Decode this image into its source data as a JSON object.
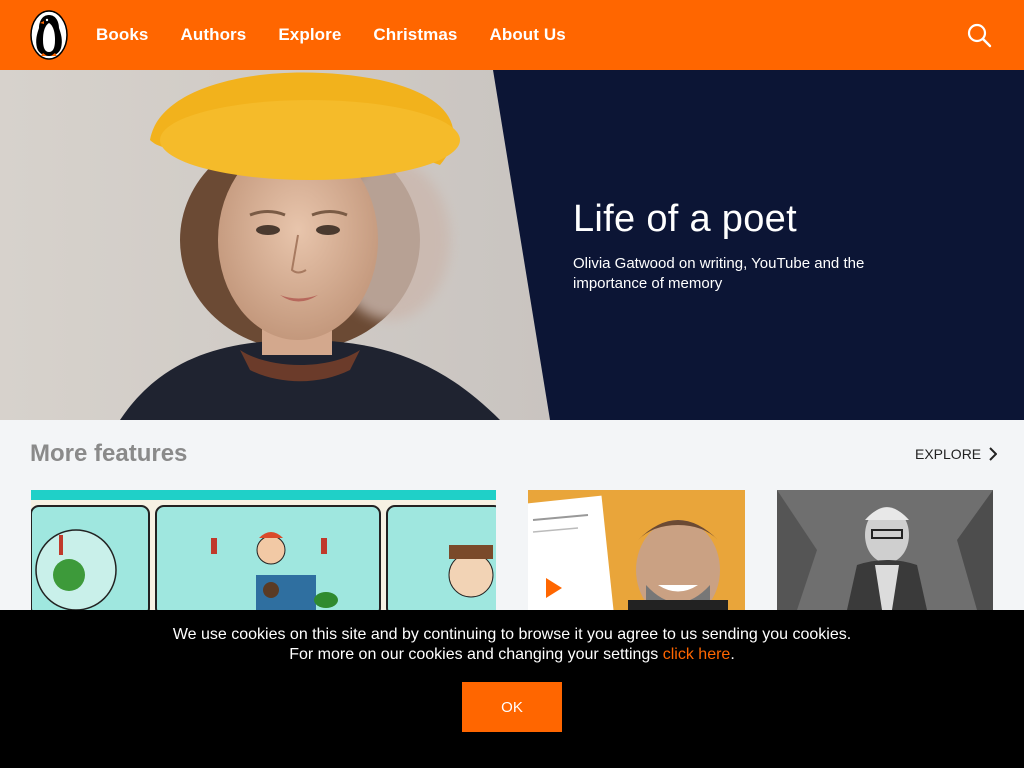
{
  "brand": {
    "logo_icon": "penguin-logo-icon",
    "accent": "#ff6600"
  },
  "nav": {
    "items": [
      "Books",
      "Authors",
      "Explore",
      "Christmas",
      "About Us"
    ],
    "search_icon": "search-icon"
  },
  "hero": {
    "title": "Life of a poet",
    "subtitle": "Olivia Gatwood on writing, YouTube and the importance of memory",
    "background": "#0c1535"
  },
  "features": {
    "title": "More features",
    "explore_label": "EXPLORE"
  },
  "cookie": {
    "line1": "We use cookies on this site and by continuing to browse it you agree to us sending you cookies.",
    "line2_prefix": "For more on our cookies and changing your settings ",
    "link_label": "click here",
    "line2_suffix": ".",
    "ok_label": "OK"
  }
}
